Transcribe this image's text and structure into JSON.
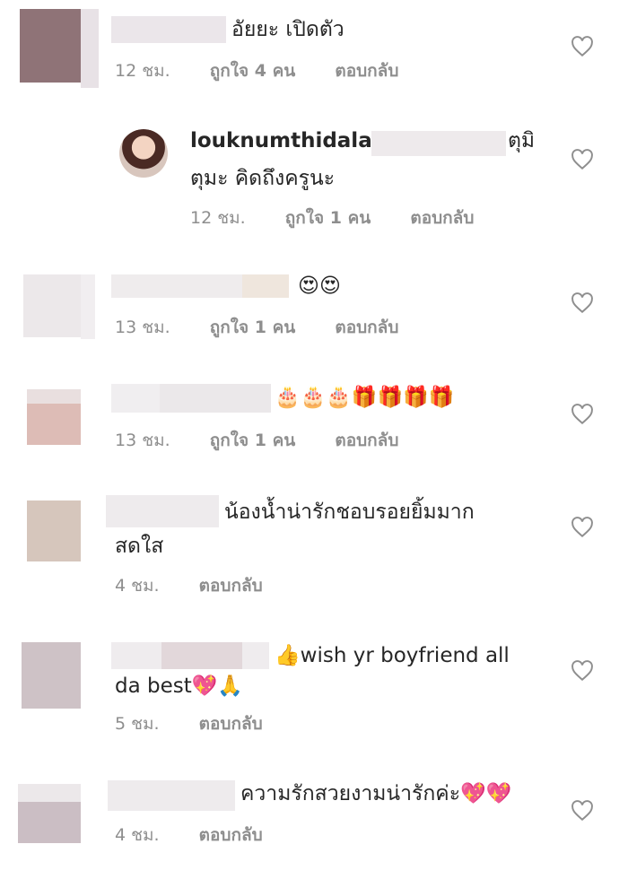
{
  "comments": [
    {
      "text": "อัยยะ เปิดตัว",
      "time": "12 ชม.",
      "likes": "ถูกใจ 4 คน",
      "reply": "ตอบกลับ"
    },
    {
      "username": "louknumthidalat",
      "text_line1": "ตุมิ",
      "text_line2": "ตุมะ คิดถึงครูนะ",
      "time": "12 ชม.",
      "likes": "ถูกใจ 1 คน",
      "reply": "ตอบกลับ"
    },
    {
      "text": "😍😍",
      "time": "13 ชม.",
      "likes": "ถูกใจ 1 คน",
      "reply": "ตอบกลับ"
    },
    {
      "text": "🎂🎂🎂🎁🎁🎁🎁",
      "time": "13 ชม.",
      "likes": "ถูกใจ 1 คน",
      "reply": "ตอบกลับ"
    },
    {
      "text_line1": "น้องน้ำน่ารักชอบรอยยิ้มมาก",
      "text_line2": "สดใส",
      "time": "4 ชม.",
      "reply": "ตอบกลับ"
    },
    {
      "text_line1": "👍wish yr boyfriend all",
      "text_line2": "da best💖🙏",
      "time": "5 ชม.",
      "reply": "ตอบกลับ"
    },
    {
      "text": "ความรักสวยงามน่ารักค่ะ💖💖",
      "time": "4 ชม.",
      "reply": "ตอบกลับ"
    }
  ],
  "icons": {
    "like": "heart-outline-icon"
  },
  "colors": {
    "text": "#262626",
    "meta": "#8e8e8e"
  }
}
